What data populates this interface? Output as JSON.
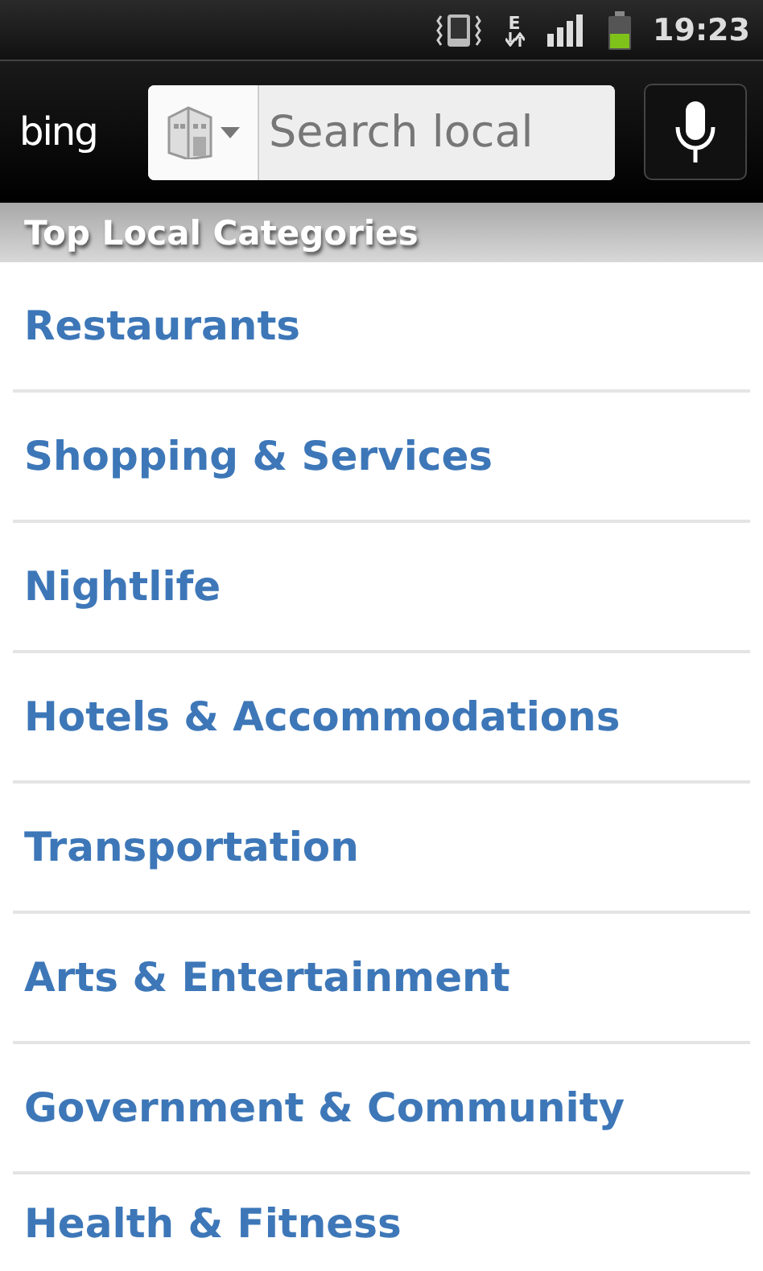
{
  "status_bar": {
    "network_type": "E",
    "time": "19:23"
  },
  "header": {
    "logo": "bing",
    "search": {
      "placeholder": "Search local"
    }
  },
  "section": {
    "title": "Top Local Categories"
  },
  "categories": [
    {
      "label": "Restaurants"
    },
    {
      "label": "Shopping & Services"
    },
    {
      "label": "Nightlife"
    },
    {
      "label": "Hotels & Accommodations"
    },
    {
      "label": "Transportation"
    },
    {
      "label": "Arts & Entertainment"
    },
    {
      "label": "Government & Community"
    },
    {
      "label": "Health & Fitness"
    }
  ]
}
